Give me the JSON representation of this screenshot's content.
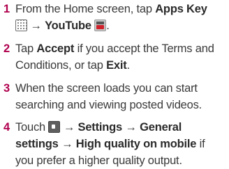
{
  "steps": [
    {
      "number": "1",
      "line1_a": "From the Home screen, tap ",
      "line1_b": "Apps Key",
      "arrow": "→",
      "line2_b": "YouTube",
      "line2_end": ".",
      "icons": [
        "apps-key-icon",
        "youtube-icon"
      ]
    },
    {
      "number": "2",
      "line1_a": "Tap ",
      "line1_b": "Accept",
      "line1_c": " if you accept the Terms and",
      "line2_a": "Conditions, or tap ",
      "line2_b": "Exit",
      "line2_c": "."
    },
    {
      "number": "3",
      "line1": "When the screen loads you can start",
      "line2": "searching and viewing posted videos."
    },
    {
      "number": "4",
      "line1_a": "Touch ",
      "arrow": "→",
      "settings": "Settings",
      "general": "General",
      "line2_a": "settings",
      "line2_b": "High quality on mobile",
      "line2_c": " if",
      "line3": "you prefer a higher quality output.",
      "icons": [
        "menu-key-icon"
      ]
    }
  ],
  "colors": {
    "number": "#b0004e",
    "text": "#3a3a3a"
  }
}
